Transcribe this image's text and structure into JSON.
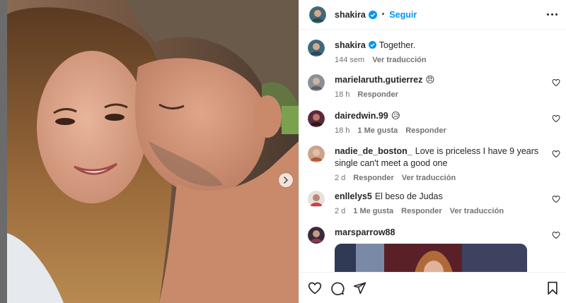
{
  "header": {
    "username": "shakira",
    "separator": "•",
    "follow_label": "Seguir",
    "more_icon": "more-horizontal-icon"
  },
  "caption": {
    "username": "shakira",
    "text": "Together.",
    "time": "144 sem",
    "translate_label": "Ver traducción"
  },
  "comments": [
    {
      "username": "marielaruth.gutierrez",
      "text": "😠",
      "time": "18 h",
      "likes": "",
      "reply": "Responder",
      "translate": ""
    },
    {
      "username": "dairedwin.99",
      "text": "😥",
      "time": "18 h",
      "likes": "1 Me gusta",
      "reply": "Responder",
      "translate": ""
    },
    {
      "username": "nadie_de_boston_",
      "text": "Love is priceless I have 9 years single can't meet a good one",
      "time": "2 d",
      "likes": "",
      "reply": "Responder",
      "translate": "Ver traducción"
    },
    {
      "username": "enllelys5",
      "text": "El beso de Judas",
      "time": "2 d",
      "likes": "1 Me gusta",
      "reply": "Responder",
      "translate": "Ver traducción"
    },
    {
      "username": "marsparrow88",
      "text": "",
      "time": "",
      "likes": "",
      "reply": "",
      "translate": ""
    }
  ],
  "icons": {
    "like": "heart-icon",
    "comment": "comment-icon",
    "share": "paper-plane-icon",
    "save": "bookmark-icon",
    "next": "chevron-right-icon",
    "verified": "verified-badge-icon"
  },
  "colors": {
    "link": "#0095f6",
    "verified": "#0095f6",
    "muted": "#737373",
    "text": "#262626"
  }
}
